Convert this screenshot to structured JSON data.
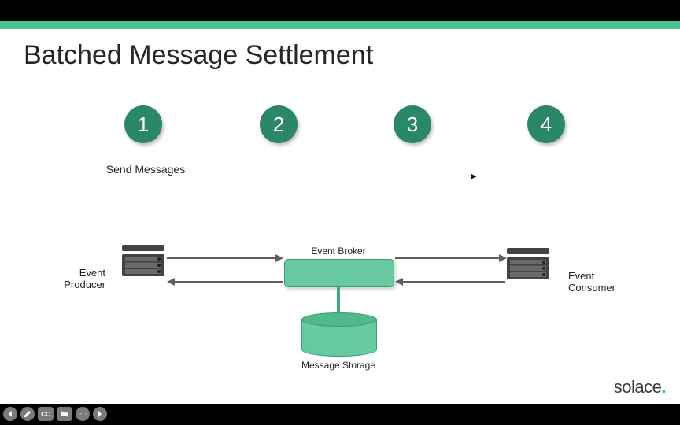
{
  "title": "Batched Message Settlement",
  "steps": [
    {
      "num": "1",
      "label": "Send Messages"
    },
    {
      "num": "2",
      "label": ""
    },
    {
      "num": "3",
      "label": ""
    },
    {
      "num": "4",
      "label": ""
    }
  ],
  "diagram": {
    "producer_label": "Event Producer",
    "consumer_label": "Event Consumer",
    "broker_label": "Event Broker",
    "storage_label": "Message Storage"
  },
  "logo": {
    "text": "solace",
    "dot": "."
  },
  "colors": {
    "accent": "#47c391",
    "circle": "#2a8866",
    "broker": "#66c9a0"
  },
  "toolbar": {
    "prev": "←",
    "pen": "✎",
    "cc": "CC",
    "cam": "■",
    "more": "⋯",
    "next": "→"
  }
}
